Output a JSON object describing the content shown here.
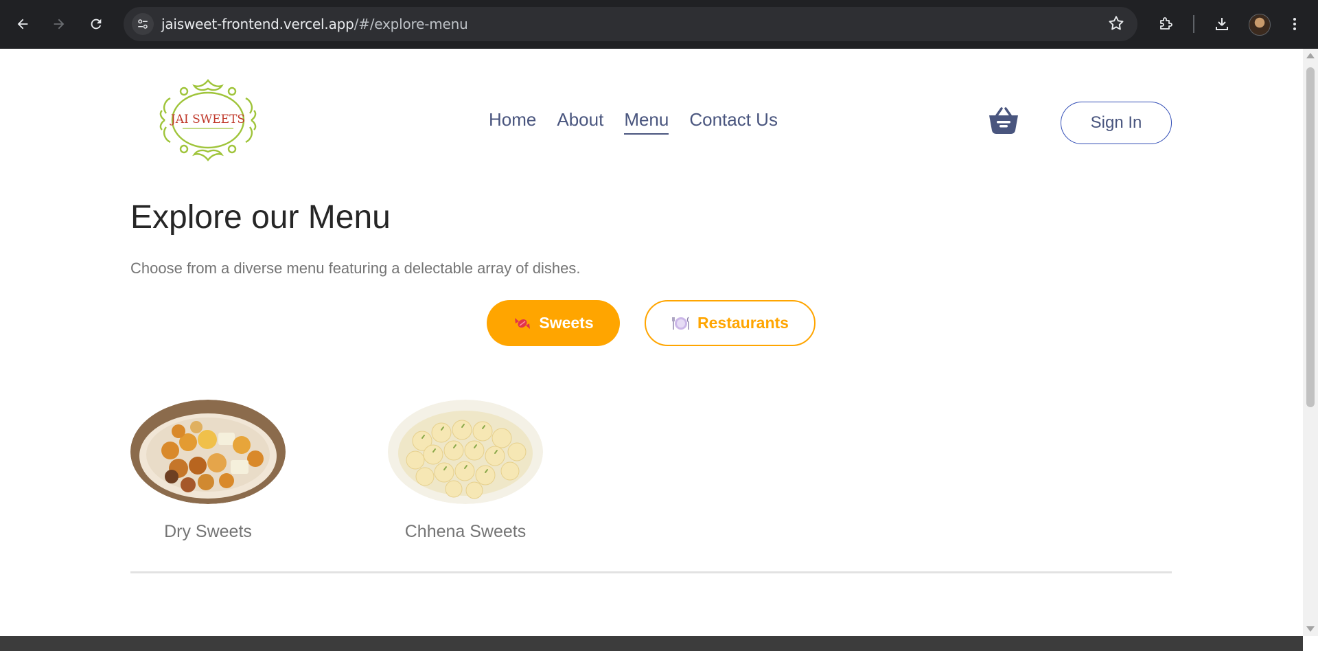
{
  "browser": {
    "url_host": "jaisweet-frontend.vercel.app",
    "url_path": "/#/explore-menu"
  },
  "site": {
    "logo_text": "JAI SWEETS",
    "nav": [
      {
        "label": "Home",
        "active": false
      },
      {
        "label": "About",
        "active": false
      },
      {
        "label": "Menu",
        "active": true
      },
      {
        "label": "Contact Us",
        "active": false
      }
    ],
    "signin_label": "Sign In"
  },
  "menu": {
    "title": "Explore our Menu",
    "subtitle": "Choose from a diverse menu featuring a delectable array of dishes.",
    "tabs": [
      {
        "label": "Sweets",
        "icon": "candy-icon",
        "selected": true
      },
      {
        "label": "Restaurants",
        "icon": "plate-icon",
        "selected": false
      }
    ],
    "categories": [
      {
        "label": "Dry Sweets",
        "image": "dry-sweets-plate"
      },
      {
        "label": "Chhena Sweets",
        "image": "chhena-sweets-plate"
      }
    ]
  },
  "colors": {
    "accent": "#ffa500",
    "nav_text": "#49557e",
    "heading": "#262626",
    "muted": "#747474"
  }
}
